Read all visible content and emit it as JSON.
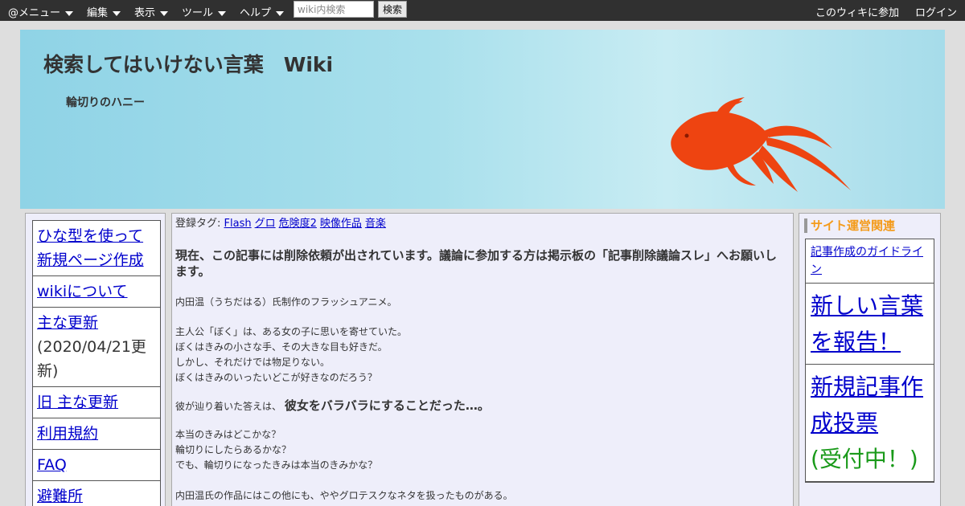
{
  "topbar": {
    "menus": [
      "@メニュー",
      "編集",
      "表示",
      "ツール",
      "ヘルプ"
    ],
    "search_placeholder": "wiki内検索",
    "search_button": "検索",
    "join_link": "このウィキに参加",
    "login_link": "ログイン"
  },
  "banner": {
    "site_title": "検索してはいけない言葉　Wiki",
    "page_title": "輪切りのハニー"
  },
  "left_menu": {
    "items": [
      {
        "label": "ひな型を使って新規ページ作成"
      },
      {
        "label": "wikiについて"
      },
      {
        "label": "主な更新",
        "note": "(2020/04/21更新)"
      },
      {
        "label": "旧 主な更新"
      },
      {
        "label": "利用規約"
      },
      {
        "label": "FAQ"
      },
      {
        "label": "避難所"
      }
    ]
  },
  "main": {
    "tags_label": "登録タグ:",
    "tags": [
      "Flash",
      "グロ",
      "危険度2",
      "映像作品",
      "音楽"
    ],
    "deletion_notice": "現在、この記事には削除依頼が出されています。議論に参加する方は掲示板の「記事削除議論スレ」へお願いします。",
    "intro": "内田温（うちだはる）氏制作のフラッシュアニメ。",
    "story_lines": [
      "主人公「ぼく」は、ある女の子に思いを寄せていた。",
      "ぼくはきみの小さな手、その大きな目も好きだ。",
      "しかし、それだけでは物足りない。",
      "ぼくはきみのいったいどこが好きなのだろう？"
    ],
    "answer_prefix": "彼が辿り着いた答えは、",
    "answer_emphasis": "彼女をバラバラにすることだった…。",
    "question_lines": [
      "本当のきみはどこかな？",
      "輪切りにしたらあるかな？",
      "でも、輪切りになったきみは本当のきみかな？"
    ],
    "other_works": "内田温氏の作品にはこの他にも、ややグロテスクなネタを扱ったものがある。"
  },
  "right_sidebar": {
    "heading": "サイト運営関連",
    "guideline_link": "記事作成のガイドライン",
    "report_link": "新しい言葉を報告！",
    "vote_link": "新規記事作成投票",
    "vote_status": "(受付中！)"
  },
  "colors": {
    "topbar_bg": "#303030",
    "link": "#0000cc",
    "heading_orange": "#f49b1a",
    "status_green": "#1a9a1a",
    "goldfish": "#ee4411"
  }
}
